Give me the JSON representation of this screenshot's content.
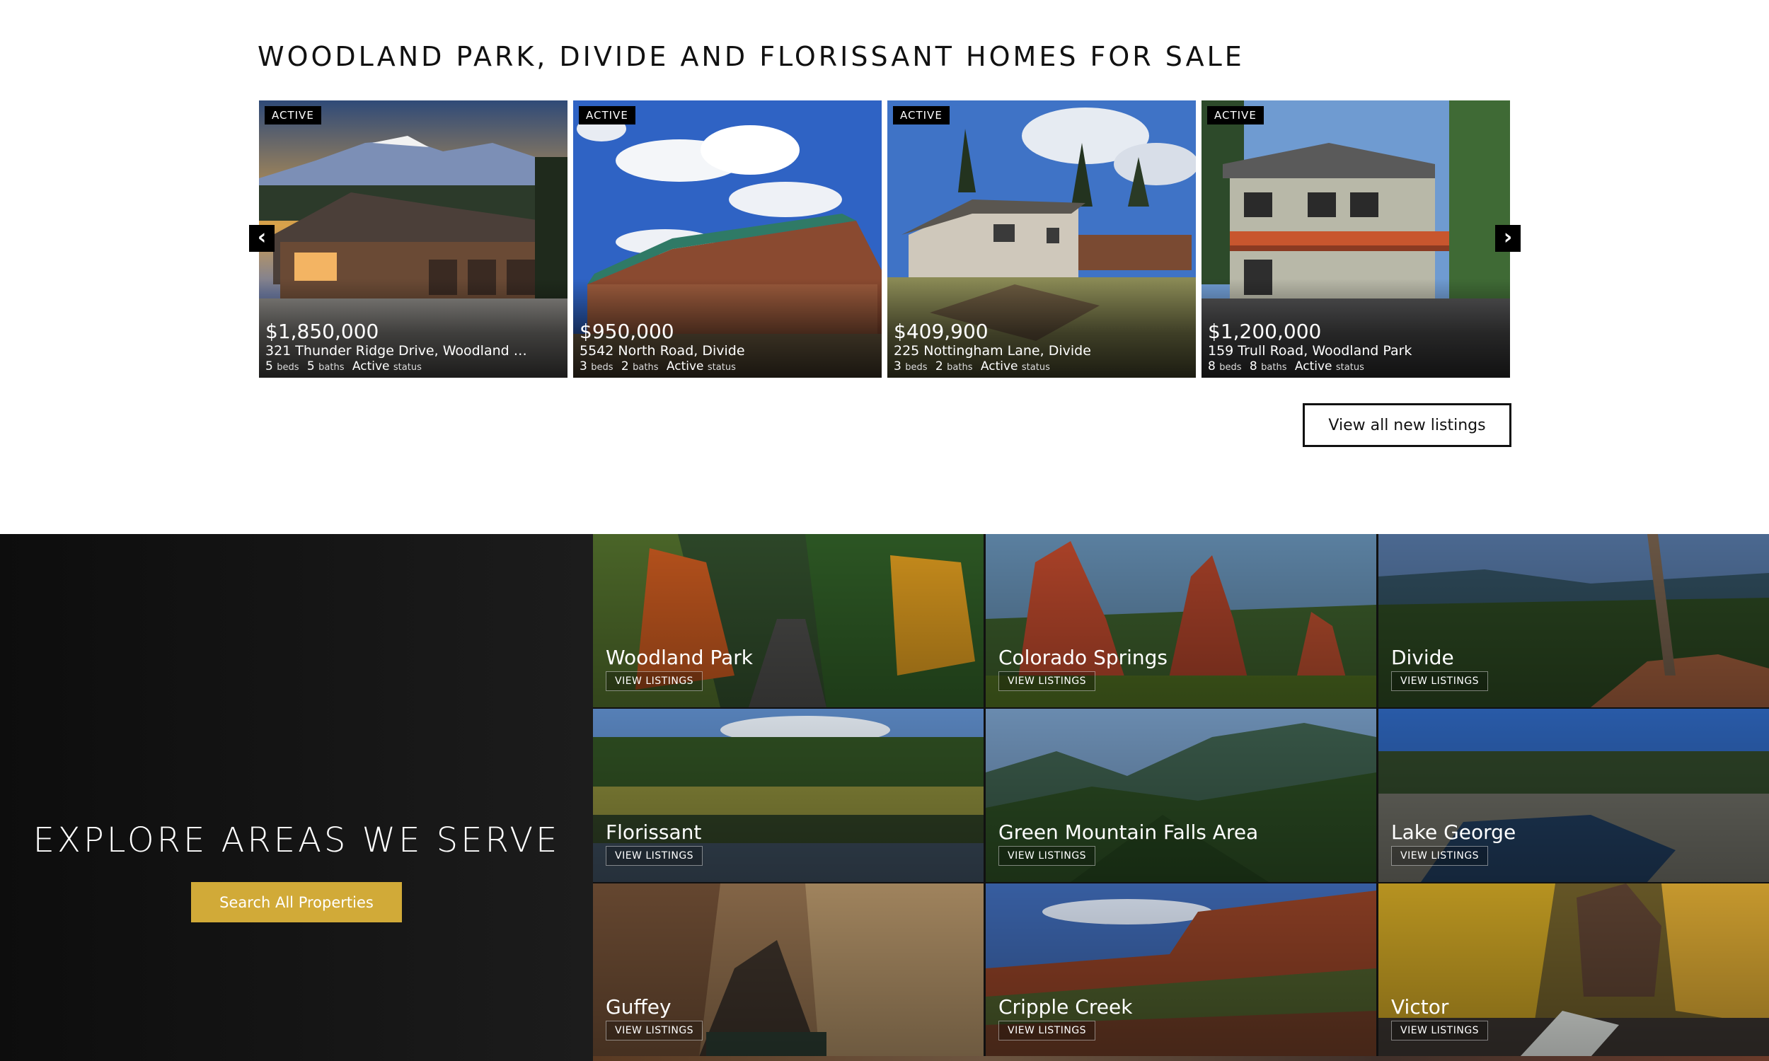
{
  "listings": {
    "title": "WOODLAND PARK, DIVIDE AND FLORISSANT HOMES FOR SALE",
    "prev_icon": "chevron-left-icon",
    "next_icon": "chevron-right-icon",
    "prev_glyph": "‹",
    "next_glyph": "›",
    "view_all_label": "View all new listings",
    "cards": [
      {
        "status_badge": "ACTIVE",
        "price": "$1,850,000",
        "address": "321 Thunder Ridge Drive, Woodland …",
        "beds": "5",
        "beds_label": "beds",
        "baths": "5",
        "baths_label": "baths",
        "status": "Active",
        "status_label": "status"
      },
      {
        "status_badge": "ACTIVE",
        "price": "$950,000",
        "address": "5542 North Road, Divide",
        "beds": "3",
        "beds_label": "beds",
        "baths": "2",
        "baths_label": "baths",
        "status": "Active",
        "status_label": "status"
      },
      {
        "status_badge": "ACTIVE",
        "price": "$409,900",
        "address": "225 Nottingham Lane, Divide",
        "beds": "3",
        "beds_label": "beds",
        "baths": "2",
        "baths_label": "baths",
        "status": "Active",
        "status_label": "status"
      },
      {
        "status_badge": "ACTIVE",
        "price": "$1,200,000",
        "address": "159 Trull Road, Woodland Park",
        "beds": "8",
        "beds_label": "beds",
        "baths": "8",
        "baths_label": "baths",
        "status": "Active",
        "status_label": "status"
      }
    ]
  },
  "areas": {
    "title": "EXPLORE AREAS WE SERVE",
    "search_label": "Search All Properties",
    "search_color": "#d1aa38",
    "view_listings_label": "VIEW LISTINGS",
    "tiles": [
      {
        "name": "Woodland Park"
      },
      {
        "name": "Colorado Springs"
      },
      {
        "name": "Divide"
      },
      {
        "name": "Florissant"
      },
      {
        "name": "Green Mountain Falls Area"
      },
      {
        "name": "Lake George"
      },
      {
        "name": "Guffey"
      },
      {
        "name": "Cripple Creek"
      },
      {
        "name": "Victor"
      }
    ]
  }
}
